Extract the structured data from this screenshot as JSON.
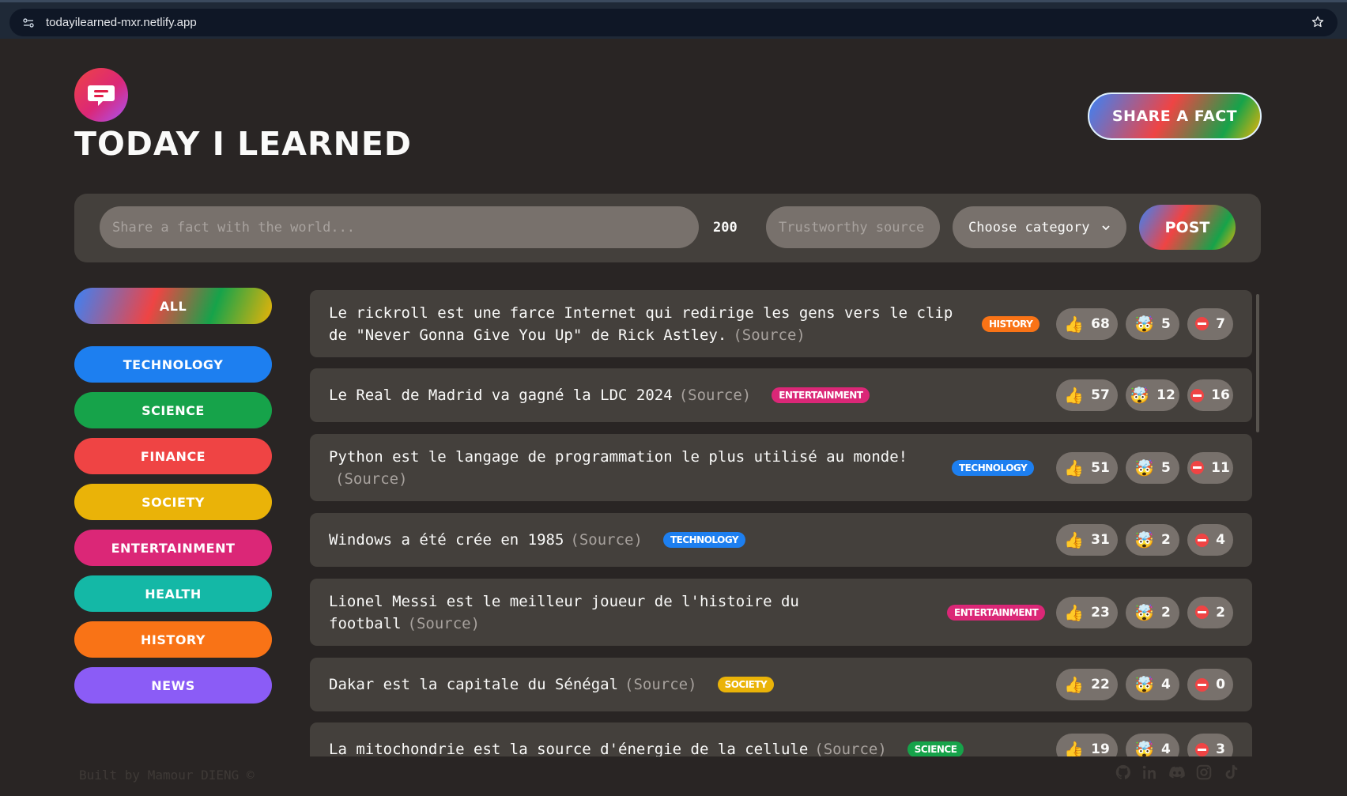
{
  "browser": {
    "url": "todayilearned-mxr.netlify.app"
  },
  "header": {
    "title": "Today I Learned",
    "share_label": "Share a fact"
  },
  "form": {
    "fact_placeholder": "Share a fact with the world...",
    "char_count": "200",
    "source_placeholder": "Trustworthy source...",
    "category_label": "Choose category",
    "post_label": "Post"
  },
  "categories": [
    {
      "label": "All",
      "color": "gradient"
    },
    {
      "label": "Technology",
      "color": "#1d7ff0"
    },
    {
      "label": "Science",
      "color": "#16a34a"
    },
    {
      "label": "Finance",
      "color": "#ef4444"
    },
    {
      "label": "Society",
      "color": "#eab308"
    },
    {
      "label": "Entertainment",
      "color": "#db2777"
    },
    {
      "label": "Health",
      "color": "#14b8a6"
    },
    {
      "label": "History",
      "color": "#f97316"
    },
    {
      "label": "News",
      "color": "#8b5cf6"
    }
  ],
  "facts": [
    {
      "text": "Le rickroll est une farce Internet qui redirige les gens vers le clip de \"Never Gonna Give You Up\" de Rick Astley.",
      "source": "(Source)",
      "category": "History",
      "tag_color": "#f97316",
      "likes": "68",
      "mindblowing": "5",
      "false": "7"
    },
    {
      "text": "Le Real de Madrid va gagné la LDC 2024",
      "source": "(Source)",
      "category": "Entertainment",
      "tag_color": "#db2777",
      "likes": "57",
      "mindblowing": "12",
      "false": "16"
    },
    {
      "text": "Python est le langage de programmation le plus utilisé au monde!",
      "source": "(Source)",
      "category": "Technology",
      "tag_color": "#1d7ff0",
      "likes": "51",
      "mindblowing": "5",
      "false": "11"
    },
    {
      "text": "Windows a été crée en 1985",
      "source": "(Source)",
      "category": "Technology",
      "tag_color": "#1d7ff0",
      "likes": "31",
      "mindblowing": "2",
      "false": "4"
    },
    {
      "text": "Lionel Messi est le meilleur joueur de l'histoire du football",
      "source": "(Source)",
      "category": "Entertainment",
      "tag_color": "#db2777",
      "likes": "23",
      "mindblowing": "2",
      "false": "2"
    },
    {
      "text": "Dakar est la capitale du Sénégal",
      "source": "(Source)",
      "category": "Society",
      "tag_color": "#eab308",
      "likes": "22",
      "mindblowing": "4",
      "false": "0"
    },
    {
      "text": "La mitochondrie est la source d'énergie de la cellule",
      "source": "(Source)",
      "category": "Science",
      "tag_color": "#16a34a",
      "likes": "19",
      "mindblowing": "4",
      "false": "3"
    }
  ],
  "footer": {
    "text": "Built by Mamour DIENG ©"
  },
  "social_icons": [
    "github-icon",
    "linkedin-icon",
    "discord-icon",
    "instagram-icon",
    "tiktok-icon"
  ]
}
